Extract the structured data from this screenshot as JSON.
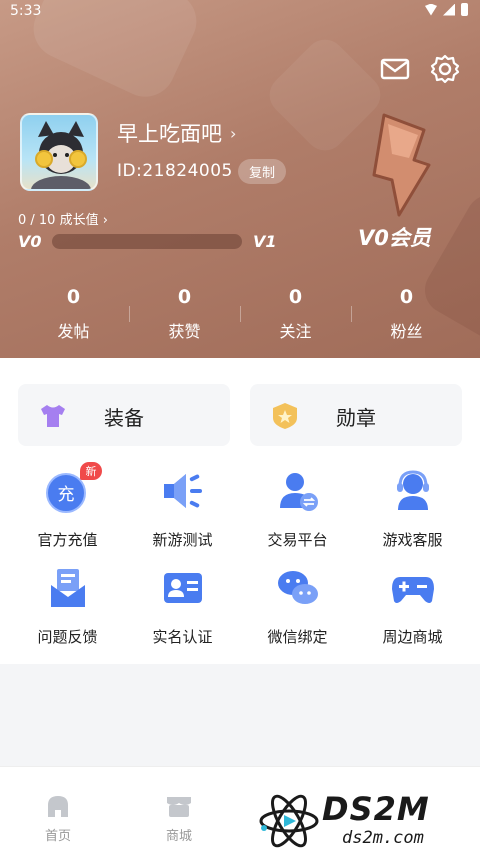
{
  "status_bar": {
    "time": "5:33"
  },
  "profile": {
    "username": "早上吃面吧",
    "chevron": "›",
    "id_text": "ID:21824005",
    "copy_label": "复制",
    "growth_text": "0 / 10 成长值 ›",
    "level_current": "V0",
    "level_next": "V1",
    "growth_progress": 0,
    "vip_label": "V0会员"
  },
  "stats": [
    {
      "value": "0",
      "label": "发帖"
    },
    {
      "value": "0",
      "label": "获赞"
    },
    {
      "value": "0",
      "label": "关注"
    },
    {
      "value": "0",
      "label": "粉丝"
    }
  ],
  "pills": [
    {
      "label": "装备",
      "icon": "tshirt-icon"
    },
    {
      "label": "勋章",
      "icon": "medal-icon"
    }
  ],
  "services": [
    {
      "label": "官方充值",
      "icon": "recharge-icon",
      "badge": "新",
      "glyph": "充"
    },
    {
      "label": "新游测试",
      "icon": "megaphone-icon"
    },
    {
      "label": "交易平台",
      "icon": "trade-icon"
    },
    {
      "label": "游戏客服",
      "icon": "headset-icon"
    },
    {
      "label": "问题反馈",
      "icon": "feedback-icon"
    },
    {
      "label": "实名认证",
      "icon": "id-card-icon"
    },
    {
      "label": "微信绑定",
      "icon": "wechat-icon"
    },
    {
      "label": "周边商城",
      "icon": "gamepad-icon"
    }
  ],
  "bottom_nav": [
    {
      "label": "首页",
      "icon": "home-icon"
    },
    {
      "label": "商城",
      "icon": "store-icon"
    }
  ],
  "watermark": {
    "title": "DS2M",
    "subtitle": "ds2m.com"
  },
  "colors": {
    "header": "#b07d69",
    "accent_blue": "#4a7cf0",
    "badge_red": "#f04a4a"
  }
}
